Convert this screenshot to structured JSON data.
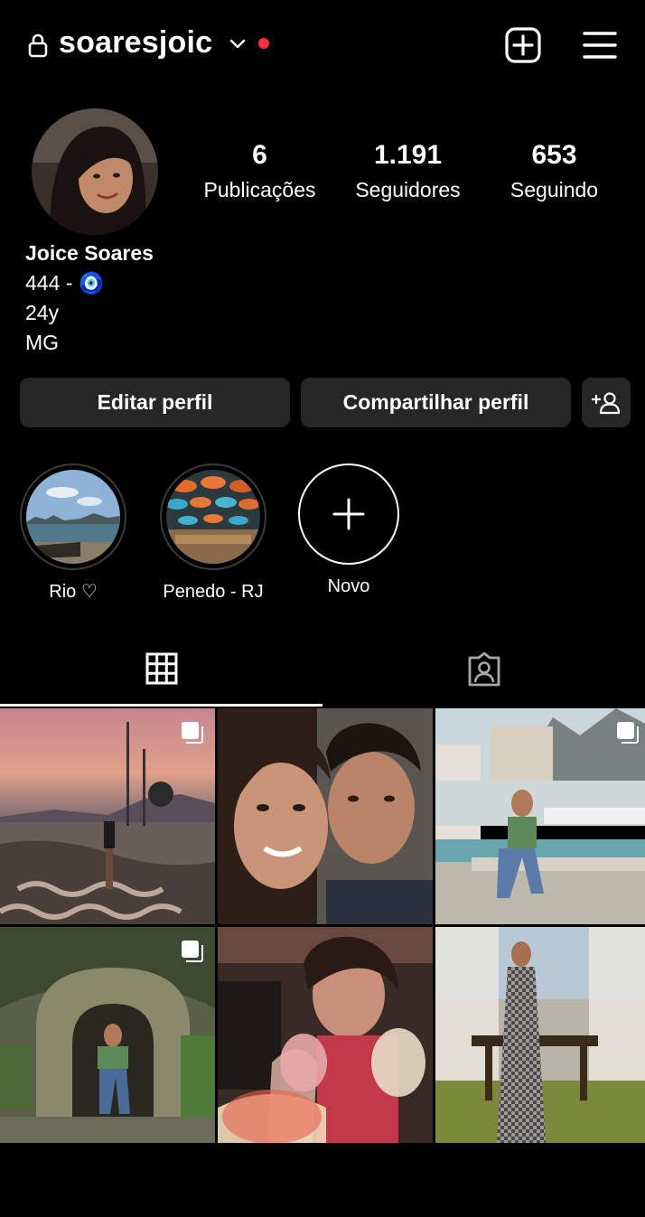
{
  "header": {
    "username": "soaresjoic",
    "lock_icon": "lock-icon",
    "chevron_icon": "chevron-down-icon",
    "notification_color": "#ff3040",
    "add_icon": "add-post-icon",
    "menu_icon": "hamburger-menu-icon"
  },
  "profile": {
    "stats": [
      {
        "value": "6",
        "label": "Publicações"
      },
      {
        "value": "1.191",
        "label": "Seguidores"
      },
      {
        "value": "653",
        "label": "Seguindo"
      }
    ],
    "name": "Joice Soares",
    "bio_lines": [
      "444 - 🧿",
      "24y",
      "MG"
    ]
  },
  "buttons": {
    "edit": "Editar perfil",
    "share": "Compartilhar perfil",
    "discover_icon": "add-person-icon"
  },
  "highlights": [
    {
      "label": "Rio ♡"
    },
    {
      "label": "Penedo - RJ"
    },
    {
      "label": "Novo"
    }
  ],
  "tabs": [
    {
      "icon": "grid-icon",
      "active": true
    },
    {
      "icon": "tagged-icon",
      "active": false
    }
  ],
  "colors": {
    "background": "#000000",
    "button_bg": "#262626",
    "text": "#ffffff"
  }
}
